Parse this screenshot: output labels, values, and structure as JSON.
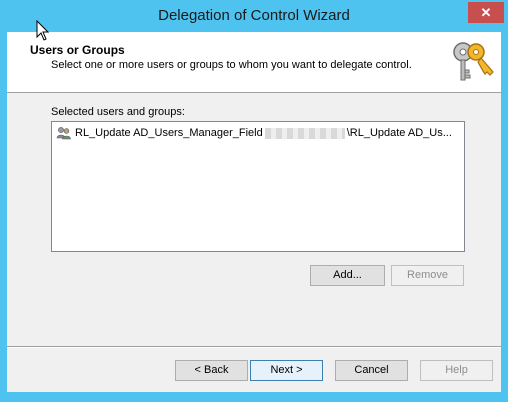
{
  "window": {
    "title": "Delegation of Control Wizard",
    "close_label": "✕"
  },
  "header": {
    "title": "Users or Groups",
    "subtitle": "Select one or more users or groups to whom you want to delegate control.",
    "icon": "keys-icon"
  },
  "list": {
    "label": "Selected users and groups:",
    "items": [
      {
        "icon": "group-icon",
        "text_start": "RL_Update AD_Users_Manager_Field",
        "text_end": "\\RL_Update AD_Us..."
      }
    ]
  },
  "buttons": {
    "add": "Add...",
    "remove": "Remove",
    "back": "< Back",
    "next": "Next >",
    "cancel": "Cancel",
    "help": "Help"
  },
  "colors": {
    "frame": "#4ec3ef",
    "close": "#c7504f",
    "dialog_bg": "#f0f0f0"
  }
}
